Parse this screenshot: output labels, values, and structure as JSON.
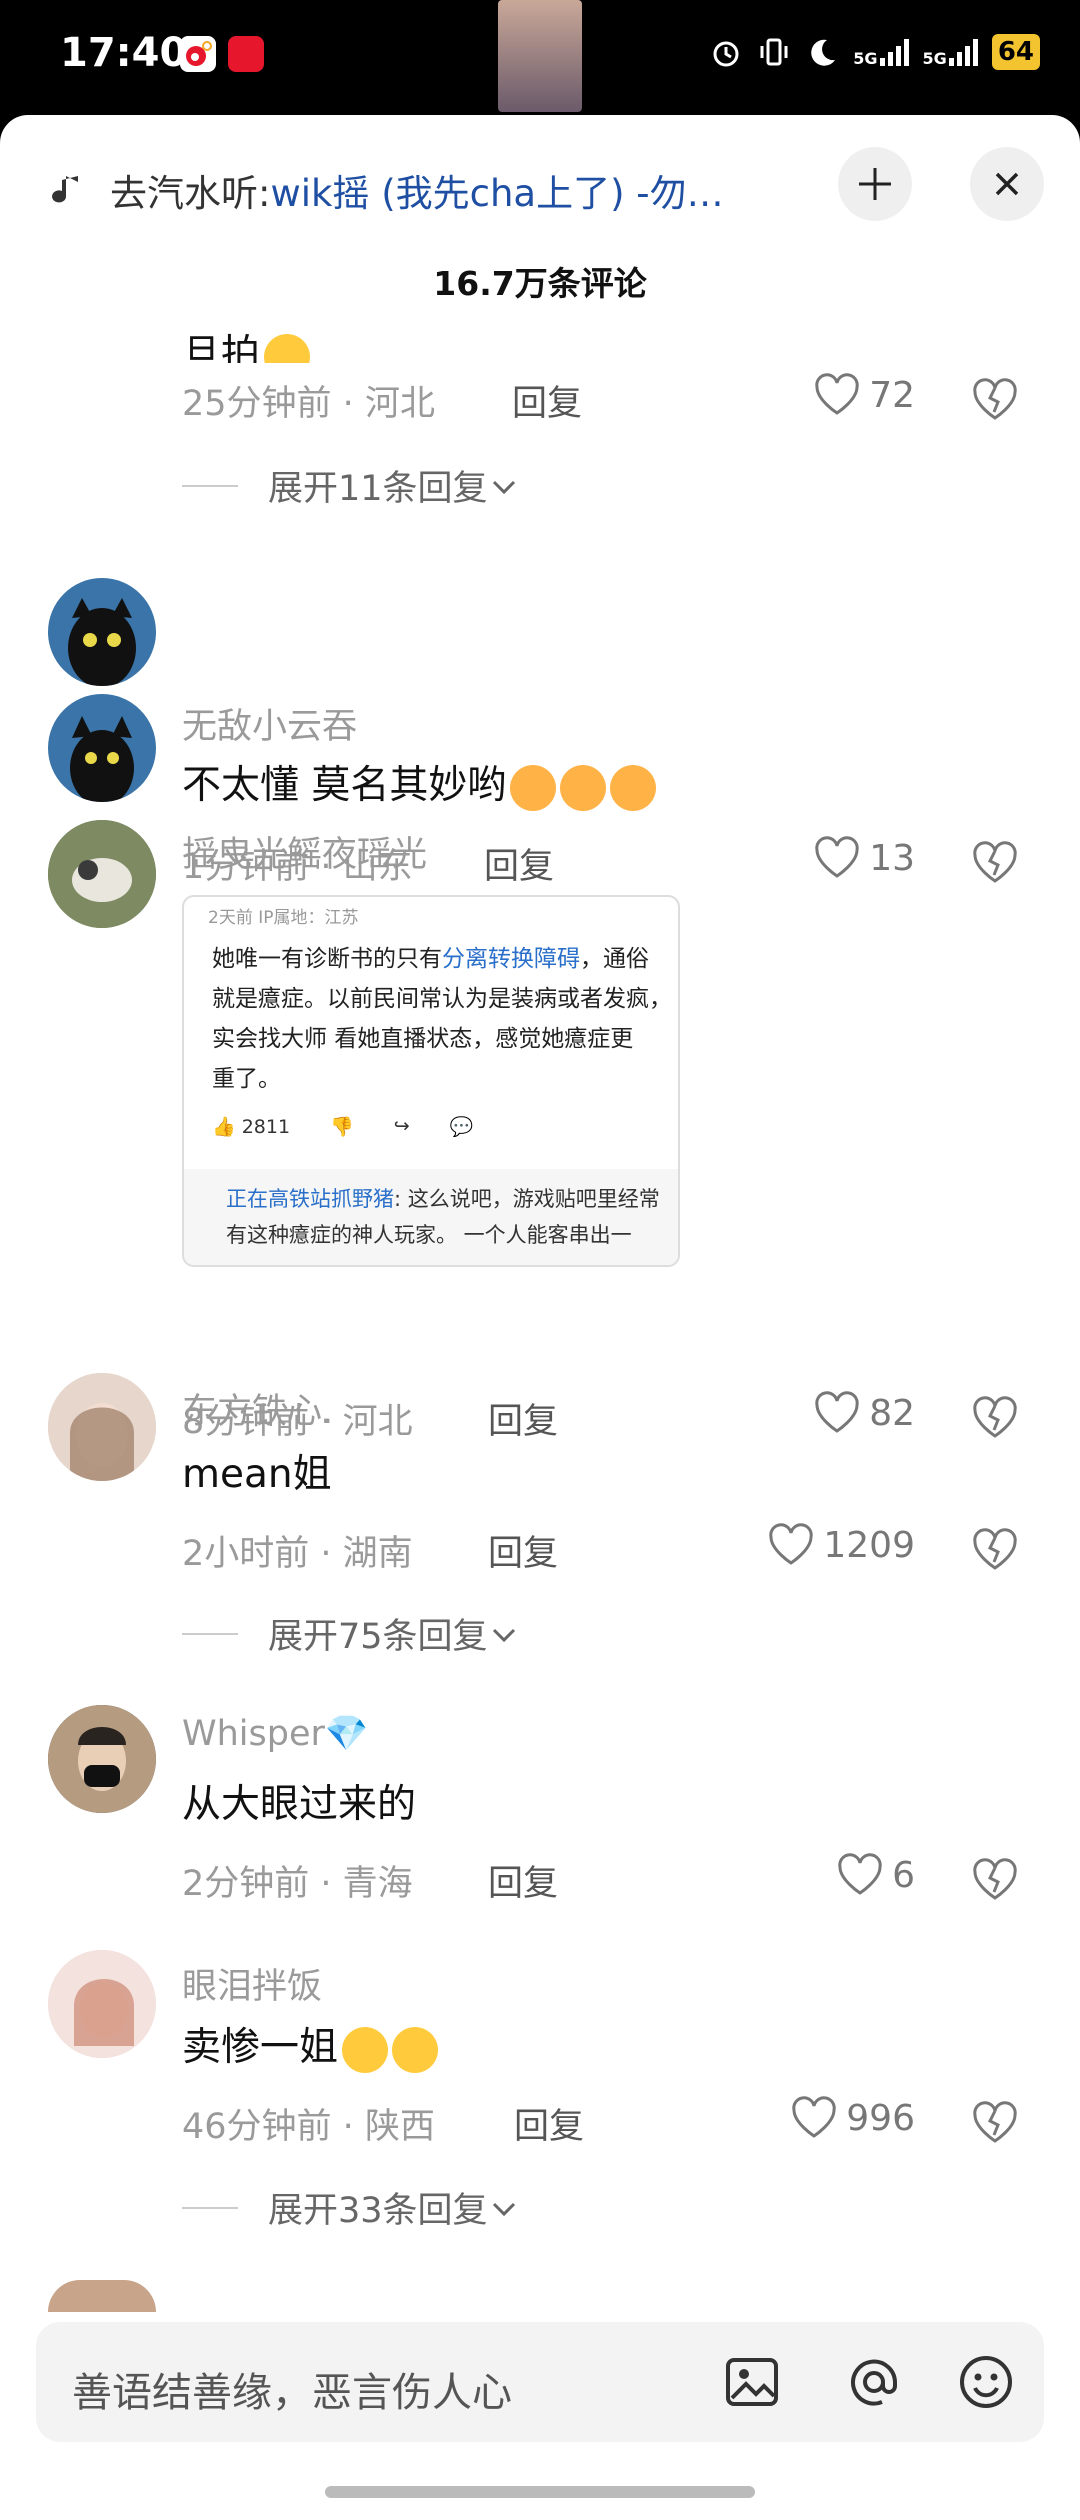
{
  "status_bar": {
    "time": "17:40",
    "network1": "5G",
    "network2": "5G",
    "battery": "64"
  },
  "header": {
    "music_prefix": "去汽水听: ",
    "music_song": "wik摇 (我先cha上了) -勿…",
    "comment_count": "16.7万条评论"
  },
  "partial_top": {
    "text": "旦拍",
    "time": "25分钟前",
    "location": "河北",
    "reply": "回复",
    "likes": "72",
    "expand": "展开11条回复"
  },
  "comments": [
    {
      "user": "无敌小云吞",
      "text": "不太懂 莫名其妙哟",
      "time": "1分钟前",
      "location": "山东",
      "reply": "回复",
      "likes": "13"
    },
    {
      "user": "摇曳光鳐夜瑶光",
      "time": "8分钟前",
      "location": "河北",
      "reply": "回复",
      "likes": "82",
      "embed": {
        "meta": "2天前 IP属地：江苏",
        "line1_a": "她唯一有诊断书的只有",
        "line1_link": "分离转换障碍",
        "line1_b": "，通俗",
        "line2": "就是癔症。以前民间常认为是装病或者发疯，",
        "line3": "实会找大师  看她直播状态，感觉她癔症更",
        "line4": "重了。",
        "likes": "2811",
        "sub_name": "正在高铁站抓野猪",
        "sub_text": ": 这么说吧，游戏贴吧里经常",
        "sub_line2": "有这种癔症的神人玩家。  一个人能客串出一"
      }
    },
    {
      "user": "东方铁心.",
      "text": "mean姐",
      "time": "2小时前",
      "location": "湖南",
      "reply": "回复",
      "likes": "1209",
      "expand": "展开75条回复"
    },
    {
      "user": "Whisper",
      "text": "从大眼过来的",
      "time": "2分钟前",
      "location": "青海",
      "reply": "回复",
      "likes": "6"
    },
    {
      "user": "眼泪拌饭",
      "text": "卖惨一姐",
      "time": "46分钟前",
      "location": "陕西",
      "reply": "回复",
      "likes": "996",
      "expand": "展开33条回复"
    }
  ],
  "input": {
    "placeholder": "善语结善缘，恶言伤人心"
  },
  "colors": {
    "link": "#1f4fa3",
    "battery": "#f4c430",
    "secondary_text": "#9a9a9a"
  }
}
